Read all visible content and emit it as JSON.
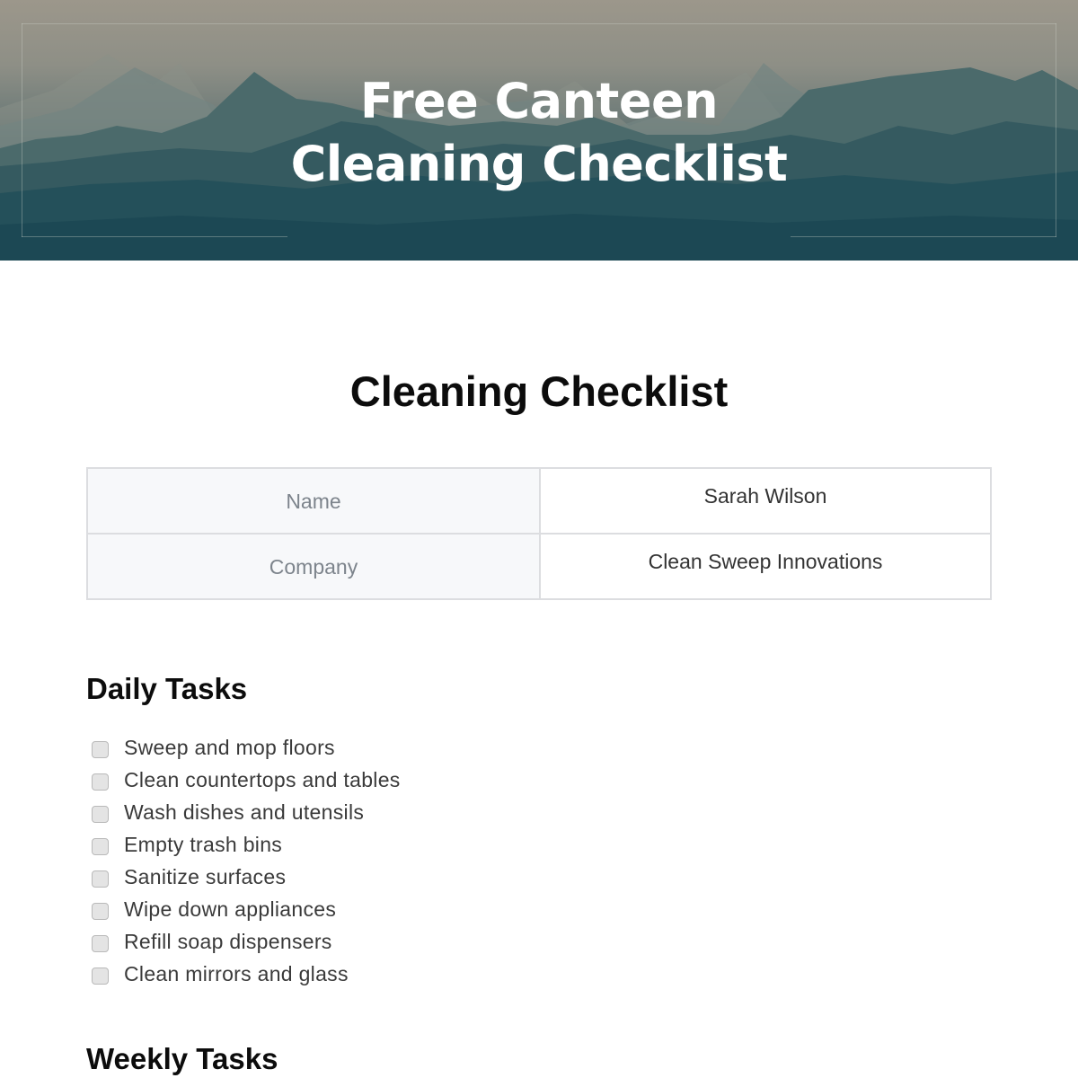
{
  "header": {
    "title_line1": "Free Canteen",
    "title_line2": "Cleaning Checklist"
  },
  "document": {
    "title": "Cleaning Checklist",
    "info_table": [
      {
        "label": "Name",
        "value": "Sarah Wilson"
      },
      {
        "label": "Company",
        "value": "Clean Sweep Innovations"
      }
    ],
    "sections": [
      {
        "heading": "Daily Tasks",
        "tasks": [
          {
            "label": "Sweep and mop floors",
            "checked": false
          },
          {
            "label": "Clean countertops and tables",
            "checked": false
          },
          {
            "label": "Wash dishes and utensils",
            "checked": false
          },
          {
            "label": "Empty trash bins",
            "checked": false
          },
          {
            "label": "Sanitize surfaces",
            "checked": false
          },
          {
            "label": "Wipe down appliances",
            "checked": false
          },
          {
            "label": "Refill soap dispensers",
            "checked": false
          },
          {
            "label": "Clean mirrors and glass",
            "checked": false
          }
        ]
      },
      {
        "heading": "Weekly Tasks",
        "tasks": []
      }
    ]
  },
  "colors": {
    "hero_top": "#9c978b",
    "hero_bottom": "#1b4855",
    "table_label_bg": "#f7f8fa",
    "table_border": "#dcdde0"
  }
}
